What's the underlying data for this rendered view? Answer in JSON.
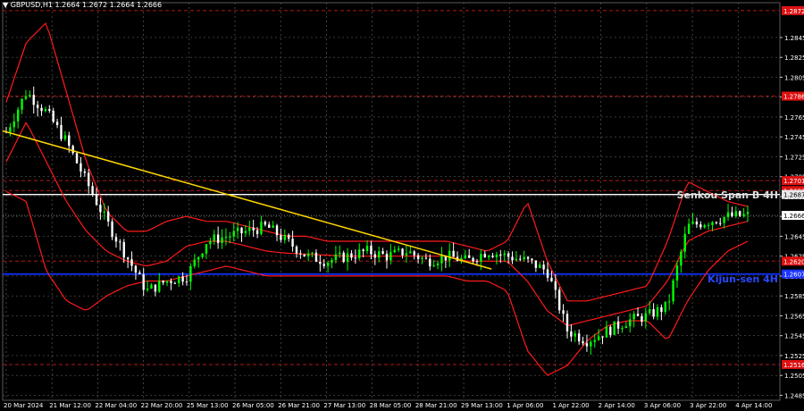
{
  "window": {
    "header_text": "GBPUSD,H1  1.2664 1.2672 1.2664 1.2666"
  },
  "labels": {
    "senkou": "Senkou Span B 4H",
    "kijun": "Kijun-sen 4H"
  },
  "colors": {
    "background": "#000000",
    "grid": "#5a5a5a",
    "bull_candle": "#00ff00",
    "bear_candle": "#ffffff",
    "bollinger": "#ff1a1a",
    "trend_line": "#ffd700",
    "kijun_line": "#1030ff",
    "senkou_line": "#ffffff",
    "level_line": "#b01818",
    "axis_text": "#ffffff",
    "current_price_box": "#ffffff",
    "level_box": "#dd1111",
    "kijun_box": "#1a33ff"
  },
  "chart_data": {
    "type": "candlestick",
    "symbol": "GBPUSD",
    "timeframe": "H1",
    "ylim": [
      1.248,
      1.288
    ],
    "y_ticks": [
      "1.2845",
      "1.2825",
      "1.2805",
      "1.2785",
      "1.2765",
      "1.2745",
      "1.2725",
      "1.2705",
      "1.2685",
      "1.2665",
      "1.2645",
      "1.2625",
      "1.2605",
      "1.2585",
      "1.2565",
      "1.2545",
      "1.2525",
      "1.2505",
      "1.2485"
    ],
    "x_labels": [
      "20 Mar 2024",
      "21 Mar 12:00",
      "22 Mar 04:00",
      "22 Mar 20:00",
      "25 Mar 13:00",
      "26 Mar 05:00",
      "26 Mar 21:00",
      "27 Mar 13:00",
      "28 Mar 05:00",
      "28 Mar 21:00",
      "29 Mar 13:00",
      "1 Apr 06:00",
      "1 Apr 22:00",
      "2 Apr 14:00",
      "3 Apr 06:00",
      "3 Apr 22:00",
      "4 Apr 14:00"
    ],
    "current_price": "1.2666",
    "horizontal_levels": [
      {
        "value": 1.2872,
        "label": "1.2872",
        "kind": "level"
      },
      {
        "value": 1.2786,
        "label": "1.2786",
        "kind": "level"
      },
      {
        "value": 1.2701,
        "label": "1.2701",
        "kind": "level"
      },
      {
        "value": 1.2691,
        "label": "1.2691",
        "kind": "level"
      },
      {
        "value": 1.2687,
        "label": "1.2687",
        "kind": "senkou"
      },
      {
        "value": 1.262,
        "label": "1.2620",
        "kind": "level"
      },
      {
        "value": 1.2607,
        "label": "1.2607",
        "kind": "kijun"
      },
      {
        "value": 1.2516,
        "label": "1.2516",
        "kind": "level"
      }
    ],
    "trend_line": {
      "start": {
        "x": "20 Mar 2024",
        "y": 1.2751
      },
      "end": {
        "x": "1 Apr 06:00",
        "y": 1.2612
      }
    },
    "close_path": [
      1.275,
      1.279,
      1.277,
      1.274,
      1.27,
      1.266,
      1.2625,
      1.259,
      1.26,
      1.2605,
      1.264,
      1.2645,
      1.265,
      1.2655,
      1.264,
      1.2625,
      1.262,
      1.2625,
      1.263,
      1.2625,
      1.263,
      1.262,
      1.2625,
      1.262,
      1.263,
      1.2625,
      1.262,
      1.261,
      1.255,
      1.254,
      1.255,
      1.256,
      1.2565,
      1.2575,
      1.2655,
      1.266,
      1.2665,
      1.2666
    ],
    "bollinger_upper": [
      1.278,
      1.284,
      1.286,
      1.279,
      1.272,
      1.267,
      1.265,
      1.265,
      1.266,
      1.2665,
      1.266,
      1.266,
      1.2655,
      1.265,
      1.2645,
      1.2645,
      1.264,
      1.264,
      1.264,
      1.264,
      1.264,
      1.264,
      1.264,
      1.2635,
      1.263,
      1.264,
      1.268,
      1.262,
      1.258,
      1.258,
      1.2585,
      1.259,
      1.2595,
      1.264,
      1.27,
      1.269,
      1.268,
      1.2675
    ],
    "bollinger_middle": [
      1.272,
      1.276,
      1.272,
      1.268,
      1.265,
      1.263,
      1.262,
      1.2615,
      1.262,
      1.2635,
      1.264,
      1.264,
      1.2635,
      1.263,
      1.2628,
      1.2627,
      1.2626,
      1.2625,
      1.2625,
      1.2625,
      1.2625,
      1.2625,
      1.2625,
      1.262,
      1.262,
      1.262,
      1.26,
      1.257,
      1.2555,
      1.256,
      1.2565,
      1.257,
      1.2575,
      1.26,
      1.264,
      1.265,
      1.2655,
      1.266
    ],
    "bollinger_lower": [
      1.269,
      1.268,
      1.261,
      1.258,
      1.257,
      1.2585,
      1.2595,
      1.26,
      1.26,
      1.2605,
      1.261,
      1.2615,
      1.261,
      1.2605,
      1.2605,
      1.2605,
      1.2605,
      1.2605,
      1.2605,
      1.2605,
      1.2605,
      1.2605,
      1.2605,
      1.26,
      1.26,
      1.259,
      1.253,
      1.2505,
      1.2515,
      1.254,
      1.2555,
      1.256,
      1.256,
      1.254,
      1.258,
      1.261,
      1.263,
      1.264
    ]
  }
}
